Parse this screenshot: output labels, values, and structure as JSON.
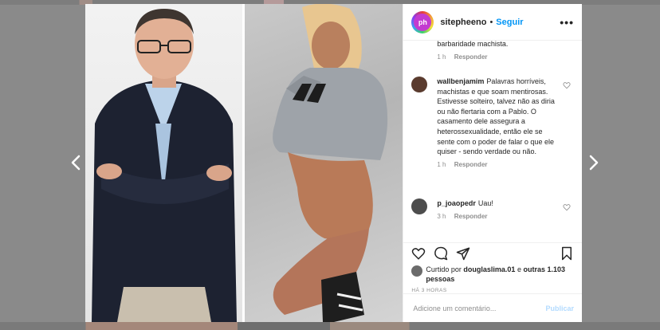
{
  "post": {
    "username": "sitepheeno",
    "separator": "•",
    "follow_label": "Seguir",
    "more_label": "•••",
    "avatar_text": "ph"
  },
  "comments": {
    "cut_text": "barbaridade machista.",
    "cut_time": "1 h",
    "reply_label": "Responder",
    "items": [
      {
        "user": "wallbenjamim",
        "text": "Palavras horríveis, machistas e que soam mentirosas. Estivesse solteiro, talvez não as diria ou não flertaria com a Pablo. O casamento dele assegura a heterossexualidade, então ele se sente com o poder de falar o que ele quiser - sendo verdade ou não.",
        "time": "1 h",
        "avatar_color": "#5a3b2e"
      },
      {
        "user": "p_joaopedr",
        "text": "Uau!",
        "time": "3 h",
        "avatar_color": "#4d4d4d"
      }
    ]
  },
  "likes": {
    "prefix": "Curtido por",
    "user": "douglaslima.01",
    "mid": "e",
    "others": "outras 1.103 pessoas"
  },
  "time_ago": "HÁ 3 HORAS",
  "composer": {
    "placeholder": "Adicione um comentário...",
    "publish_label": "Publicar"
  },
  "colors": {
    "accent": "#0095f6",
    "publish_disabled": "#b3dbff"
  }
}
